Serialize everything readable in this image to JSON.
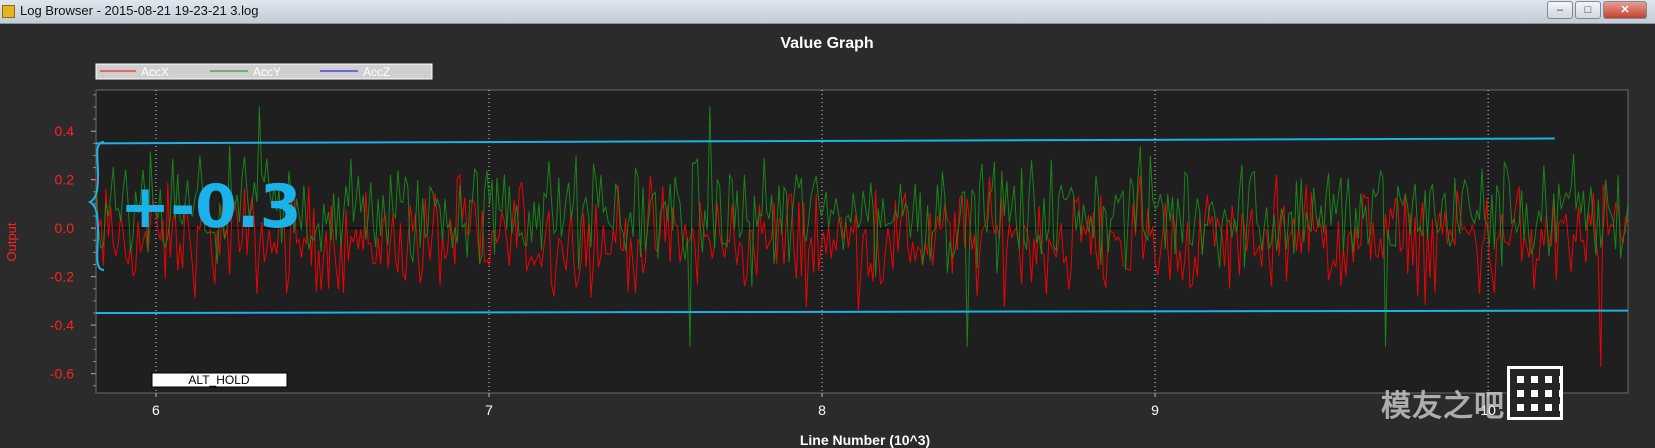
{
  "window": {
    "title": "Log Browser - 2015-08-21 19-23-21 3.log",
    "buttons": {
      "minimize": "–",
      "maximize": "□",
      "close": "✕"
    }
  },
  "annotation": {
    "text": "+-0.3",
    "color": "#1ab2e8"
  },
  "mode_label": "ALT_HOLD",
  "watermark": "模友之吧",
  "colors": {
    "AccX": "#ff0000",
    "AccY": "#1a8c1a",
    "AccZ": "#0000ff",
    "axis_text": "#ff2020",
    "plot_bg": "#1f1f1f"
  },
  "chart_data": {
    "type": "line",
    "title": "Value Graph",
    "xlabel": "Line Number (10^3)",
    "ylabel": "Output",
    "xlim": [
      5.82,
      10.42
    ],
    "ylim": [
      -0.68,
      0.57
    ],
    "xticks": [
      6,
      7,
      8,
      9,
      10
    ],
    "yticks": [
      0.4,
      0.2,
      0.0,
      -0.2,
      -0.4,
      -0.6
    ],
    "ytick_labels": [
      "0.4",
      "0.2",
      "0.0",
      "-0.2",
      "-0.4",
      "-0.6"
    ],
    "legend": [
      "AccX",
      "AccY",
      "AccZ"
    ],
    "legend_position": "top-left",
    "grid": true,
    "series": [
      {
        "name": "AccX",
        "color": "#ff0000",
        "mean": -0.05,
        "min": -0.63,
        "max": 0.25,
        "n": 620
      },
      {
        "name": "AccY",
        "color": "#1a8c1a",
        "mean": 0.06,
        "min": -0.55,
        "max": 0.55,
        "n": 620
      },
      {
        "name": "AccZ",
        "color": "#0000ff",
        "mean": 0.0,
        "min": 0.0,
        "max": 0.0,
        "n": 0
      }
    ],
    "reference_lines": [
      {
        "x": [
          5.82,
          10.2
        ],
        "y": [
          0.35,
          0.37
        ]
      },
      {
        "x": [
          5.82,
          10.42
        ],
        "y": [
          -0.35,
          -0.34
        ]
      }
    ]
  }
}
